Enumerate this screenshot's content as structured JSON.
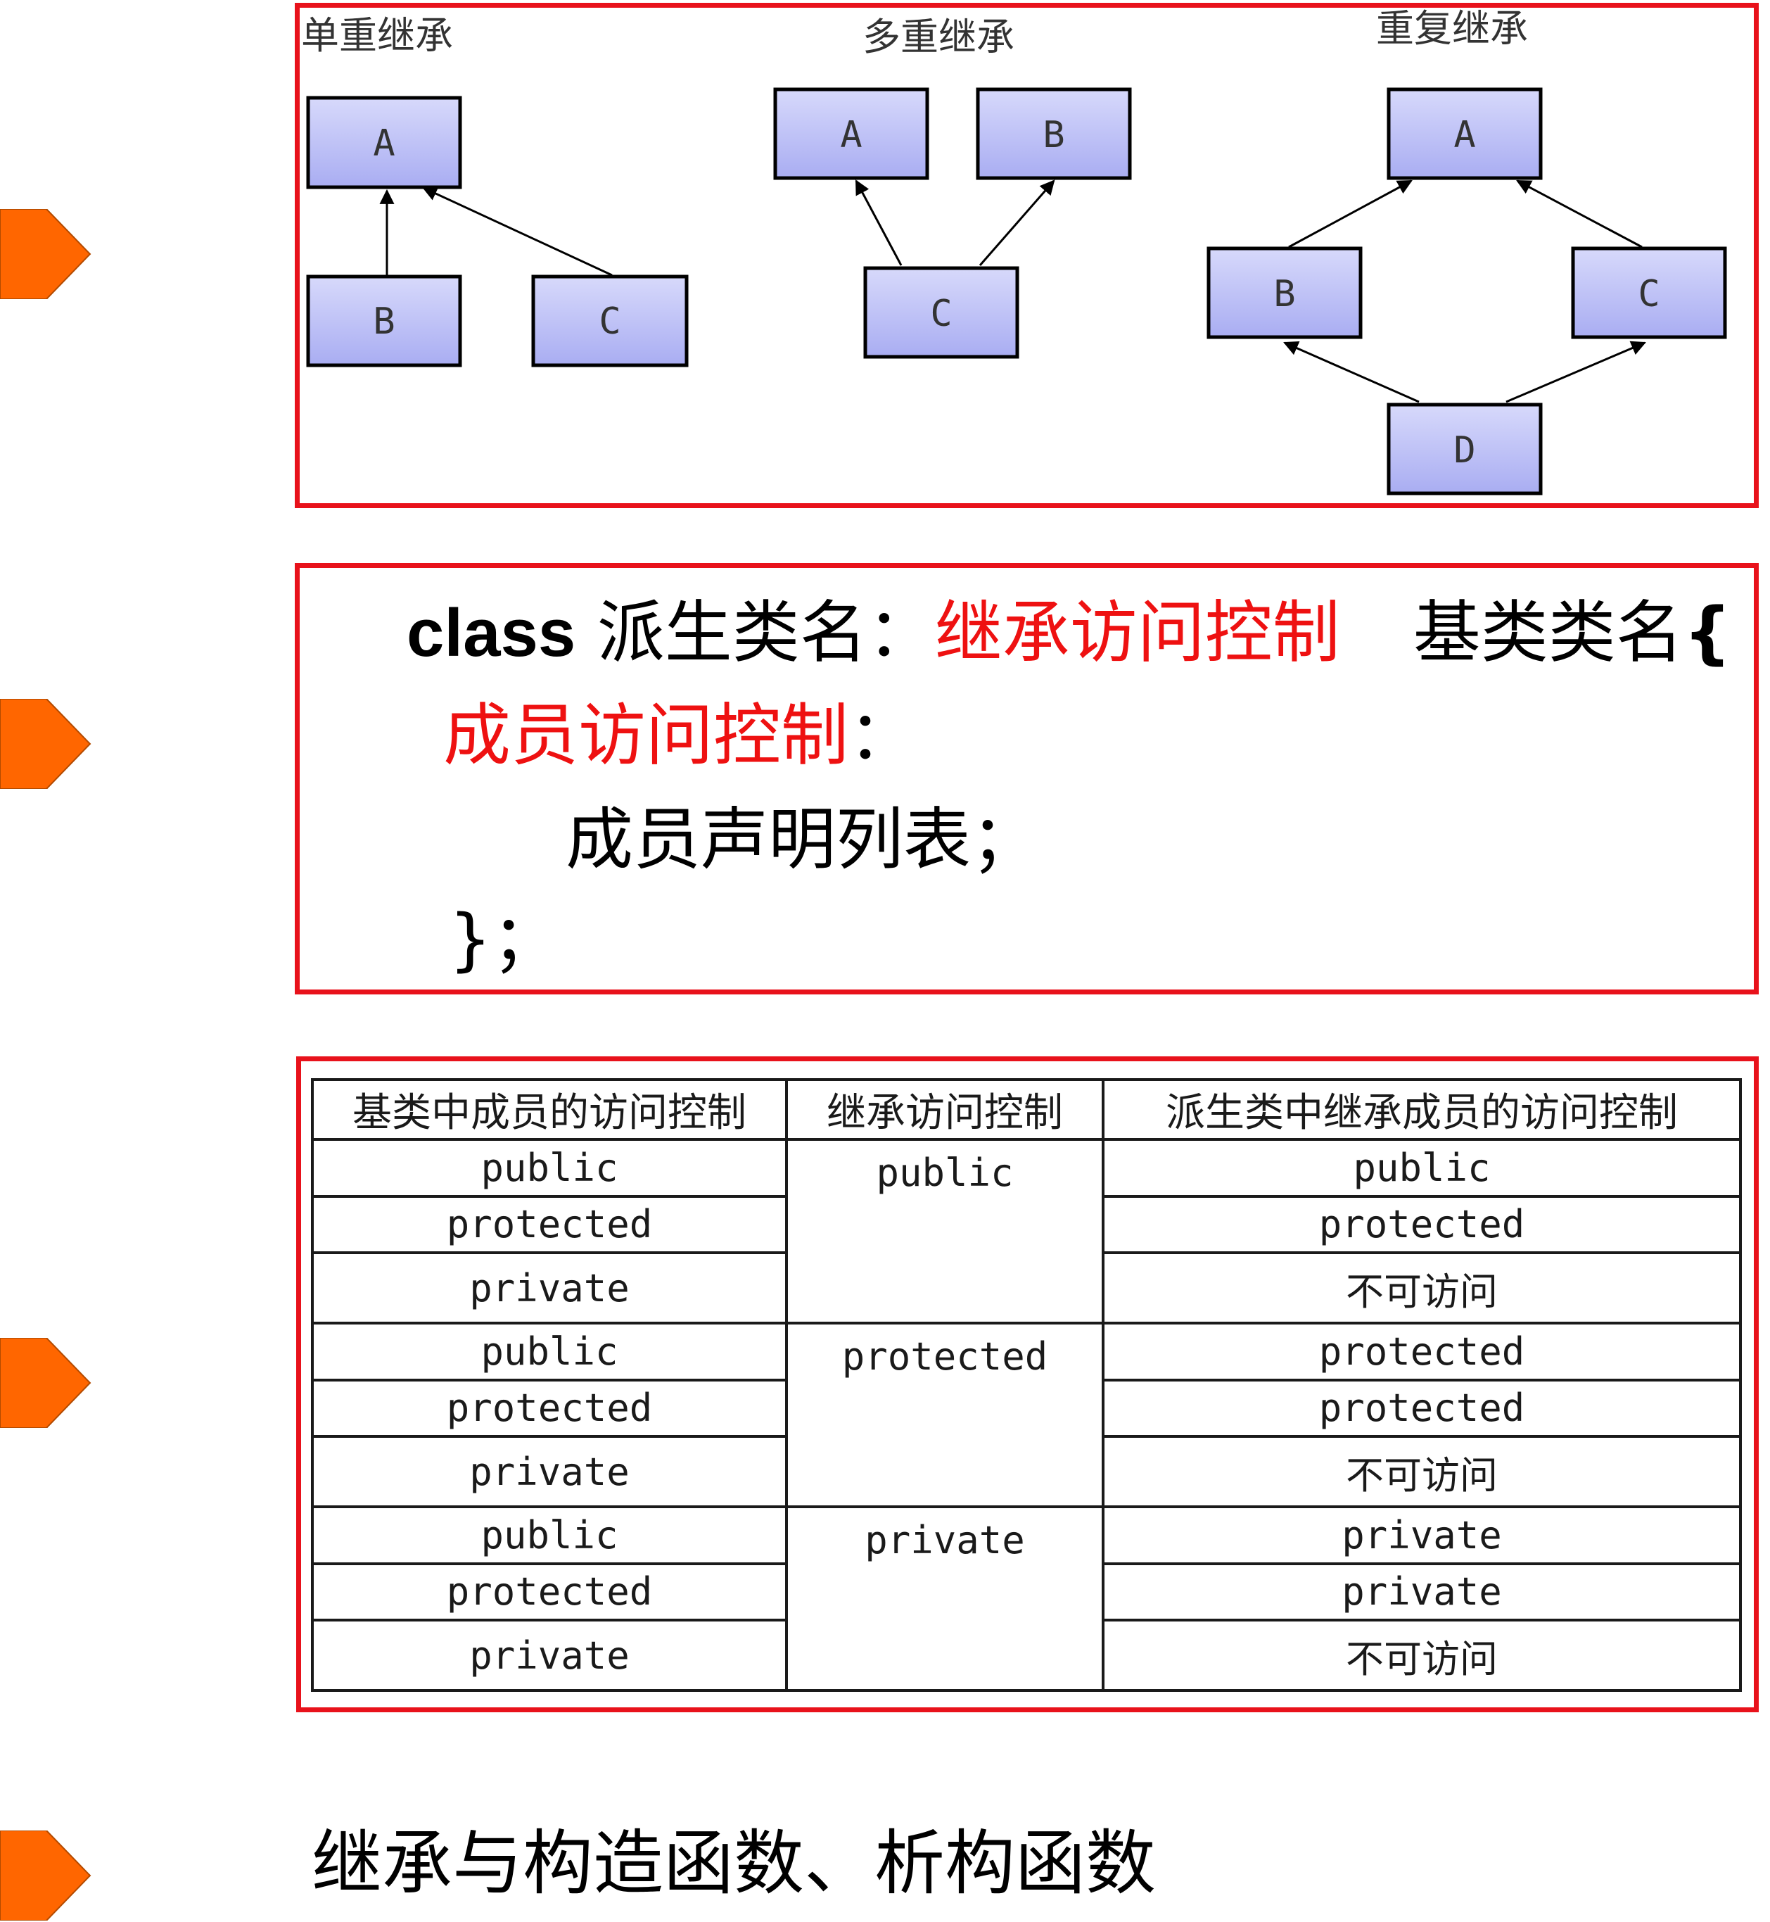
{
  "colors": {
    "bullet": "#ff6600",
    "box_border": "#e8121b",
    "highlight_text": "#ee1111",
    "node_fill": "#b8bcf6"
  },
  "diagram": {
    "single": {
      "title": "单重继承",
      "nodes": {
        "a": "A",
        "b": "B",
        "c": "C"
      }
    },
    "multiple": {
      "title": "多重继承",
      "nodes": {
        "a": "A",
        "b": "B",
        "c": "C"
      }
    },
    "repeated": {
      "title": "重复继承",
      "nodes": {
        "a": "A",
        "b": "B",
        "c": "C",
        "d": "D"
      }
    }
  },
  "syntax": {
    "line1": {
      "keyword": "class",
      "derived": " 派生类名：",
      "access": "继承访问控制",
      "base": "基类类名",
      "brace": "{"
    },
    "line2": {
      "access": "成员访问控制",
      "colon": "："
    },
    "line3": {
      "members": "成员声明列表；"
    },
    "line4": {
      "close": "}；"
    }
  },
  "table": {
    "headers": [
      "基类中成员的访问控制",
      "继承访问控制",
      "派生类中继承成员的访问控制"
    ],
    "groups": [
      {
        "inheritance": "public",
        "rows": [
          {
            "base": "public",
            "derived": "public"
          },
          {
            "base": "protected",
            "derived": "protected"
          },
          {
            "base": "private",
            "derived": "不可访问"
          }
        ]
      },
      {
        "inheritance": "protected",
        "rows": [
          {
            "base": "public",
            "derived": "protected"
          },
          {
            "base": "protected",
            "derived": "protected"
          },
          {
            "base": "private",
            "derived": "不可访问"
          }
        ]
      },
      {
        "inheritance": "private",
        "rows": [
          {
            "base": "public",
            "derived": "private"
          },
          {
            "base": "protected",
            "derived": "private"
          },
          {
            "base": "private",
            "derived": "不可访问"
          }
        ]
      }
    ]
  },
  "bottom": {
    "text": "继承与构造函数、析构函数"
  }
}
